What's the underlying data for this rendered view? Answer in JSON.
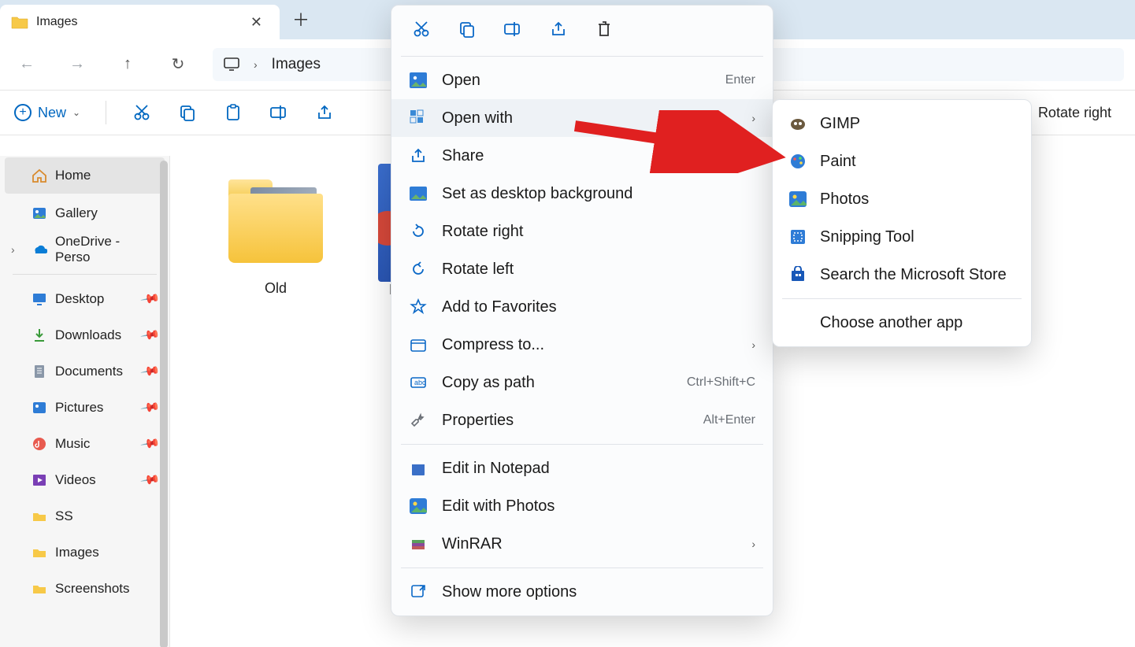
{
  "tab": {
    "title": "Images"
  },
  "address": {
    "path": "Images"
  },
  "toolbar": {
    "new_label": "New",
    "rotate_right": "Rotate right"
  },
  "sidebar": {
    "home": "Home",
    "gallery": "Gallery",
    "onedrive": "OneDrive - Perso",
    "quick": {
      "desktop": "Desktop",
      "downloads": "Downloads",
      "documents": "Documents",
      "pictures": "Pictures",
      "music": "Music",
      "videos": "Videos",
      "ss": "SS",
      "images": "Images",
      "screenshots": "Screenshots"
    }
  },
  "files": {
    "old": "Old",
    "pool": "Po"
  },
  "context_menu": {
    "open": {
      "label": "Open",
      "shortcut": "Enter"
    },
    "open_with": "Open with",
    "share": "Share",
    "set_bg": "Set as desktop background",
    "rotate_right": "Rotate right",
    "rotate_left": "Rotate left",
    "favorites": "Add to Favorites",
    "compress": "Compress to...",
    "copy_path": {
      "label": "Copy as path",
      "shortcut": "Ctrl+Shift+C"
    },
    "properties": {
      "label": "Properties",
      "shortcut": "Alt+Enter"
    },
    "edit_notepad": "Edit in Notepad",
    "edit_photos": "Edit with Photos",
    "winrar": "WinRAR",
    "more": "Show more options"
  },
  "open_with_menu": {
    "gimp": "GIMP",
    "paint": "Paint",
    "photos": "Photos",
    "snipping": "Snipping Tool",
    "store": "Search the Microsoft Store",
    "another": "Choose another app"
  }
}
